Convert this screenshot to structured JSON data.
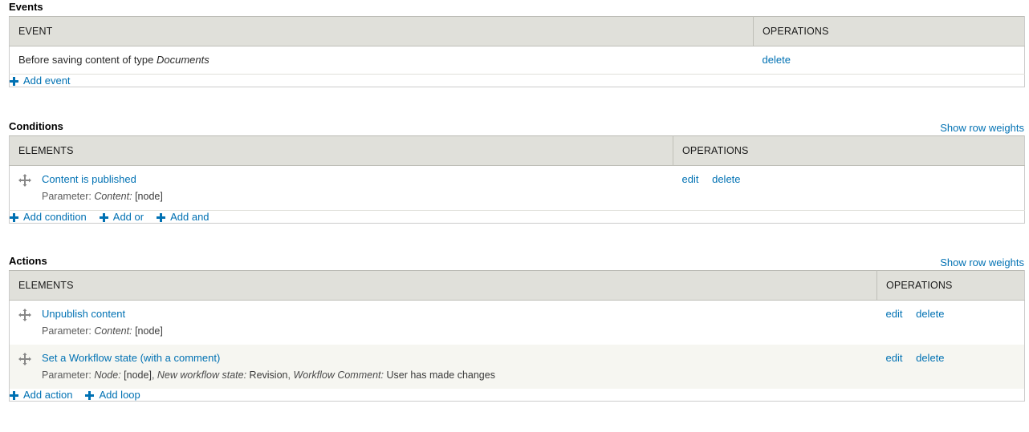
{
  "colors": {
    "link": "#0071b3",
    "header_bg": "#e0e0da",
    "add_row_bg": "#e8eff7",
    "stripe_bg": "#f6f6f1",
    "text": "#333333"
  },
  "sections": {
    "events": {
      "title": "Events",
      "columns": {
        "element": "EVENT",
        "operations": "OPERATIONS"
      },
      "rows": [
        {
          "prefix": "Before saving content of type ",
          "emphasis": "Documents",
          "operations": [
            {
              "label": "delete"
            }
          ]
        }
      ],
      "add_links": [
        {
          "label": "Add event",
          "icon": "plus-icon"
        }
      ]
    },
    "conditions": {
      "title": "Conditions",
      "row_weights_label": "Show row weights",
      "columns": {
        "element": "ELEMENTS",
        "operations": "OPERATIONS"
      },
      "rows": [
        {
          "name": "Content is published",
          "param_label": "Parameter:",
          "params": [
            {
              "key": "Content:",
              "value": "[node]"
            }
          ],
          "operations": [
            {
              "label": "edit"
            },
            {
              "label": "delete"
            }
          ]
        }
      ],
      "add_links": [
        {
          "label": "Add condition",
          "icon": "plus-icon"
        },
        {
          "label": "Add or",
          "icon": "plus-icon"
        },
        {
          "label": "Add and",
          "icon": "plus-icon"
        }
      ]
    },
    "actions": {
      "title": "Actions",
      "row_weights_label": "Show row weights",
      "columns": {
        "element": "ELEMENTS",
        "operations": "OPERATIONS"
      },
      "rows": [
        {
          "name": "Unpublish content",
          "param_label": "Parameter:",
          "params": [
            {
              "key": "Content:",
              "value": "[node]"
            }
          ],
          "operations": [
            {
              "label": "edit"
            },
            {
              "label": "delete"
            }
          ]
        },
        {
          "name": "Set a Workflow state (with a comment)",
          "param_label": "Parameter:",
          "params": [
            {
              "key": "Node:",
              "value": "[node]"
            },
            {
              "key": "New workflow state:",
              "value": "Revision"
            },
            {
              "key": "Workflow Comment:",
              "value": "User has made changes"
            }
          ],
          "operations": [
            {
              "label": "edit"
            },
            {
              "label": "delete"
            }
          ]
        }
      ],
      "add_links": [
        {
          "label": "Add action",
          "icon": "plus-icon"
        },
        {
          "label": "Add loop",
          "icon": "plus-icon"
        }
      ]
    }
  }
}
